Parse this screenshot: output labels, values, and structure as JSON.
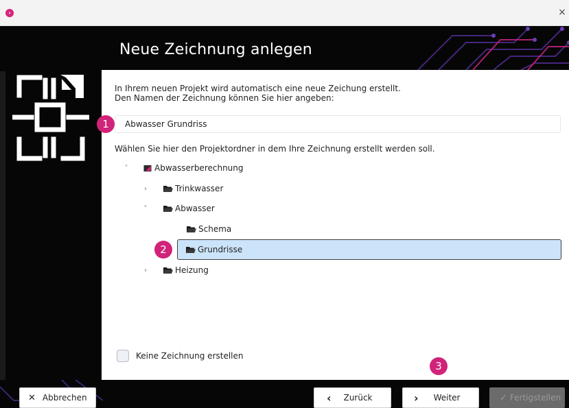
{
  "window": {
    "close_glyph": "×"
  },
  "header": {
    "title": "Neue Zeichnung anlegen"
  },
  "intro": {
    "line1": "In Ihrem neuen Projekt wird automatisch eine neue Zeichung erstellt.",
    "line2": "Den Namen der Zeichnung können Sie hier angeben:"
  },
  "name_input": {
    "value": "Abwasser Grundriss"
  },
  "folder_prompt": "Wählen Sie hier den Projektordner in dem Ihre Zeichnung erstellt werden soll.",
  "tree": [
    {
      "label": "Abwasserberechnung",
      "chevron": "˅",
      "icon": "project-icon"
    },
    {
      "label": "Trinkwasser",
      "chevron": "›",
      "icon": "folder-icon"
    },
    {
      "label": "Abwasser",
      "chevron": "˅",
      "icon": "folder-icon"
    },
    {
      "label": "Schema",
      "chevron": "",
      "icon": "folder-icon"
    },
    {
      "label": "Grundrisse",
      "chevron": "",
      "icon": "folder-icon",
      "selected": true
    },
    {
      "label": "Heizung",
      "chevron": "›",
      "icon": "folder-icon"
    }
  ],
  "no_drawing_checkbox": {
    "label": "Keine Zeichnung erstellen",
    "checked": false
  },
  "buttons": {
    "cancel": {
      "label": "Abbrechen",
      "glyph": "✕"
    },
    "back": {
      "label": "Zurück",
      "glyph": "‹"
    },
    "next": {
      "label": "Weiter",
      "glyph": "›"
    },
    "finish": {
      "label": "Fertigstellen",
      "glyph": "✓"
    }
  },
  "badges": [
    "1",
    "2",
    "3"
  ],
  "colors": {
    "accent": "#d0237a",
    "selection": "#cce4fa",
    "dark": "#060606"
  }
}
